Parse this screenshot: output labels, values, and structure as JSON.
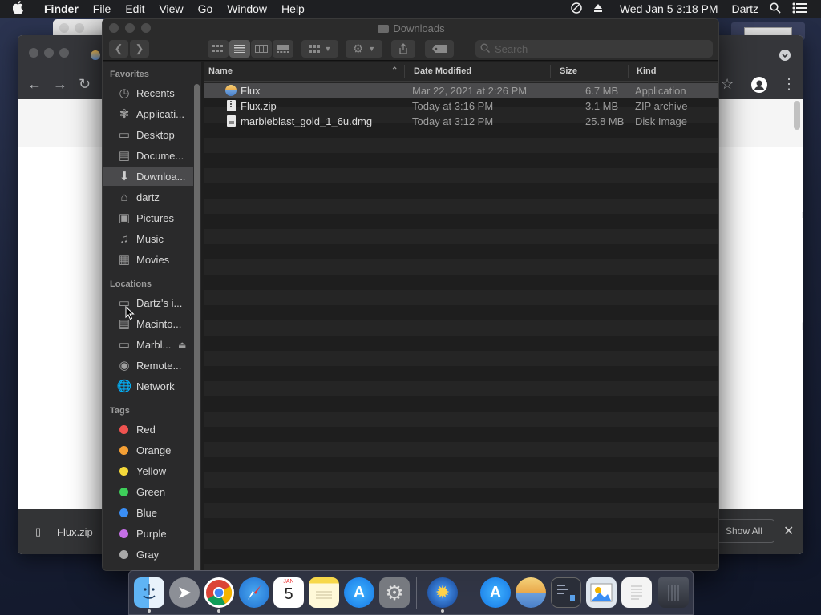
{
  "menubar": {
    "apple": "",
    "app": "Finder",
    "items": [
      "File",
      "Edit",
      "View",
      "Go",
      "Window",
      "Help"
    ],
    "clock": "Wed Jan 5  3:18 PM",
    "user": "Dartz"
  },
  "chrome": {
    "download_file": "Flux.zip",
    "show_all": "Show All",
    "right_partial_1": "m",
    "right_partial_2": "ld"
  },
  "finder": {
    "title": "Downloads",
    "search_placeholder": "Search",
    "columns": [
      "Name",
      "Date Modified",
      "Size",
      "Kind"
    ],
    "files": [
      {
        "name": "Flux",
        "date": "Mar 22, 2021 at 2:26 PM",
        "size": "6.7 MB",
        "kind": "Application",
        "icon": "flux-app-icon"
      },
      {
        "name": "Flux.zip",
        "date": "Today at 3:16 PM",
        "size": "3.1 MB",
        "kind": "ZIP archive",
        "icon": "zip-file-icon"
      },
      {
        "name": "marbleblast_gold_1_6u.dmg",
        "date": "Today at 3:12 PM",
        "size": "25.8 MB",
        "kind": "Disk Image",
        "icon": "disk-image-icon"
      }
    ]
  },
  "sidebar": {
    "favorites_label": "Favorites",
    "favorites": [
      "Recents",
      "Applicati...",
      "Desktop",
      "Docume...",
      "Downloa...",
      "dartz",
      "Pictures",
      "Music",
      "Movies"
    ],
    "locations_label": "Locations",
    "locations": [
      "Dartz's i...",
      "Macinto...",
      "Marbl...",
      "Remote...",
      "Network"
    ],
    "tags_label": "Tags",
    "tags": [
      {
        "name": "Red",
        "color": "#ef5350"
      },
      {
        "name": "Orange",
        "color": "#f5a035"
      },
      {
        "name": "Yellow",
        "color": "#f5d93a"
      },
      {
        "name": "Green",
        "color": "#3ecf5a"
      },
      {
        "name": "Blue",
        "color": "#3a8ef5"
      },
      {
        "name": "Purple",
        "color": "#c46fe6"
      },
      {
        "name": "Gray",
        "color": "#a8a8a8"
      }
    ]
  },
  "dock": {
    "calendar_month": "JAN",
    "calendar_day": "5"
  }
}
